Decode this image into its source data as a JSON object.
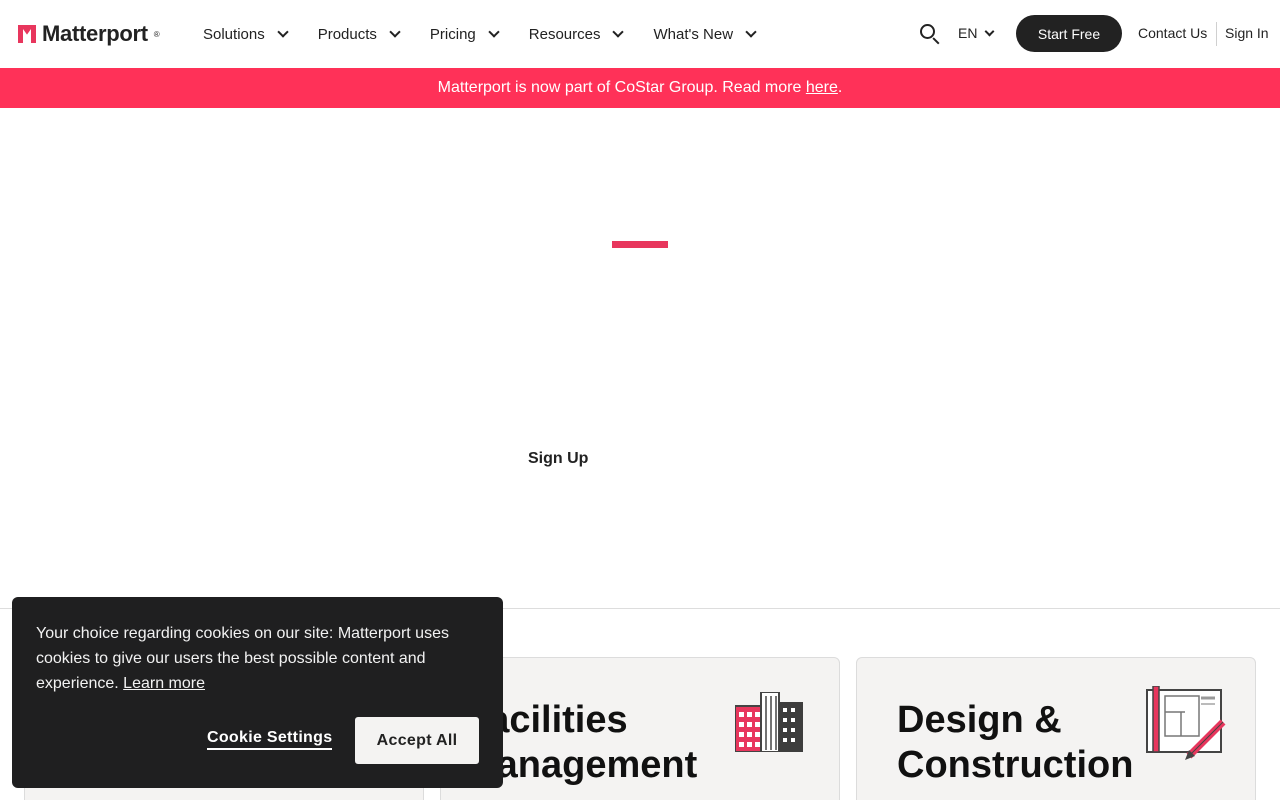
{
  "brand": {
    "name": "Matterport",
    "reg_mark": "®",
    "accent_color": "#e8365d",
    "banner_color": "#ff3158"
  },
  "nav": {
    "items": [
      {
        "label": "Solutions"
      },
      {
        "label": "Products"
      },
      {
        "label": "Pricing"
      },
      {
        "label": "Resources"
      },
      {
        "label": "What's New"
      }
    ],
    "language": "EN",
    "start_free": "Start Free",
    "contact": "Contact Us",
    "sign_in": "Sign In"
  },
  "banner": {
    "text": "Matterport is now part of CoStar Group. Read more ",
    "link": "here",
    "suffix": "."
  },
  "hero": {
    "signup": "Sign Up"
  },
  "cards": [
    {
      "title_line1": "",
      "title_line2": ""
    },
    {
      "title_line1": "Facilities",
      "title_line2": "Management",
      "icon": "building-icon"
    },
    {
      "title_line1": "Design &",
      "title_line2": "Construction",
      "icon": "blueprint-icon"
    }
  ],
  "cookie": {
    "text": "Your choice regarding cookies on our site: Matterport uses cookies to give our users the best possible content and experience. ",
    "learn_more": "Learn more",
    "settings": "Cookie Settings",
    "accept": "Accept All"
  }
}
